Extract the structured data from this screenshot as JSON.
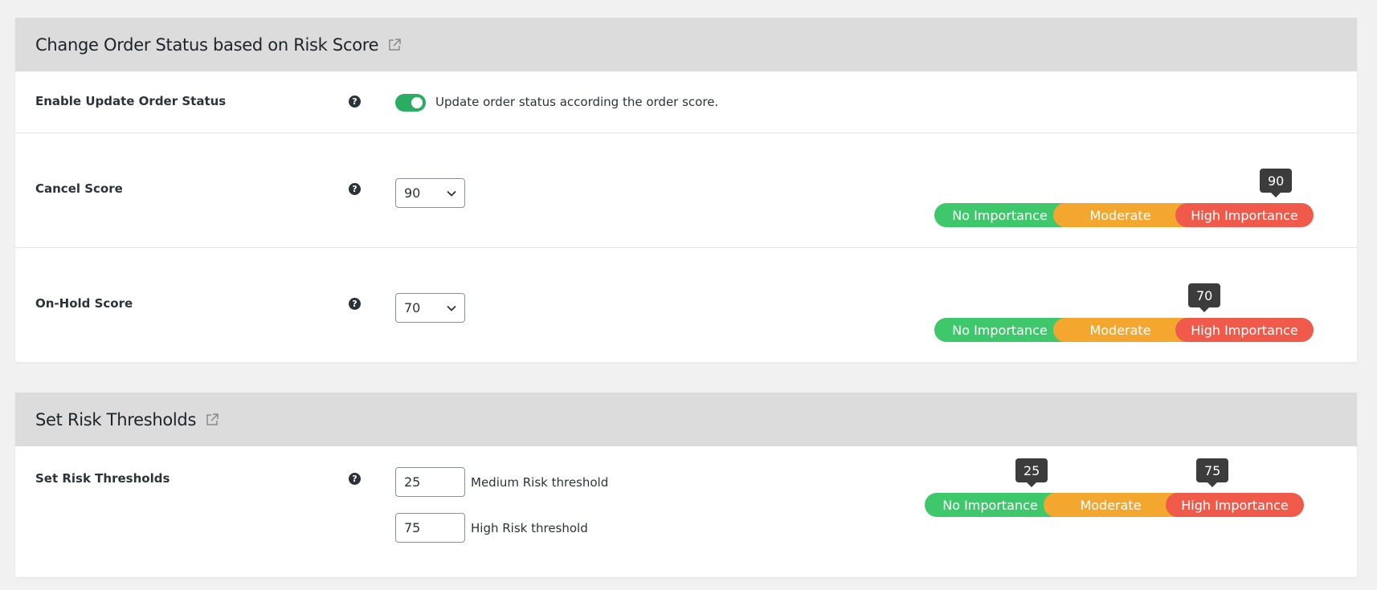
{
  "section1": {
    "title": "Change Order Status based on Risk Score",
    "enable_row": {
      "label": "Enable Update Order Status",
      "help": "?",
      "toggle_on": true,
      "description": "Update order status according the order score."
    },
    "cancel_row": {
      "label": "Cancel Score",
      "help": "?",
      "value": "90",
      "tooltip": "90"
    },
    "onhold_row": {
      "label": "On-Hold Score",
      "help": "?",
      "value": "70",
      "tooltip": "70"
    }
  },
  "section2": {
    "title": "Set Risk Thresholds",
    "row": {
      "label": "Set Risk Thresholds",
      "help": "?",
      "medium_value": "25",
      "medium_label": "Medium Risk threshold",
      "high_value": "75",
      "high_label": "High Risk threshold",
      "tooltip_medium": "25",
      "tooltip_high": "75"
    }
  },
  "importance": {
    "low": "No Importance",
    "mid": "Moderate",
    "high": "High Importance"
  },
  "colors": {
    "low": "#3ec86b",
    "mid": "#f4a72e",
    "high": "#ef5a4a",
    "toggle": "#2aad63",
    "tooltip": "#3c3c3c"
  }
}
